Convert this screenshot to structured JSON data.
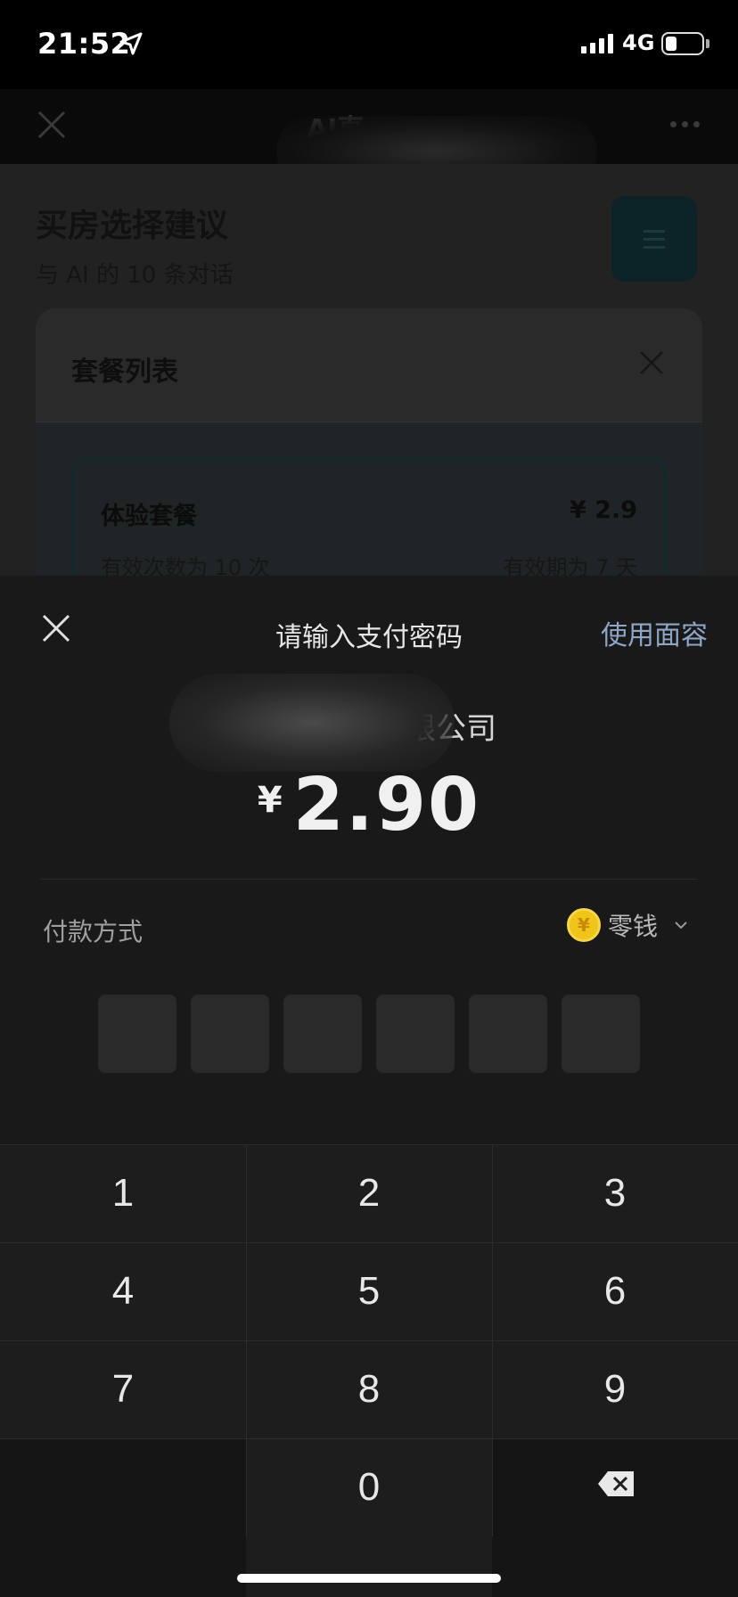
{
  "status": {
    "time": "21:52",
    "network": "4G"
  },
  "nav": {
    "title": "AI直"
  },
  "page": {
    "title": "买房选择建议",
    "subtitle": "与 AI 的 10 条对话"
  },
  "sheet": {
    "title": "套餐列表",
    "plan": {
      "name": "体验套餐",
      "price": "¥ 2.9",
      "count": "有效次数为 10 次",
      "validity": "有效期为 7 天"
    }
  },
  "payment": {
    "title": "请输入支付密码",
    "faceid_label": "使用面容",
    "merchant_suffix": "有限公司",
    "currency": "¥",
    "amount": "2.90",
    "method_label": "付款方式",
    "method_value": "零钱",
    "pin_length": 6
  },
  "keypad": {
    "keys": [
      "1",
      "2",
      "3",
      "4",
      "5",
      "6",
      "7",
      "8",
      "9",
      "0"
    ]
  },
  "colors": {
    "accent_link": "#8fa6c6",
    "coin": "#f0c419",
    "panel_bg": "#191919"
  }
}
